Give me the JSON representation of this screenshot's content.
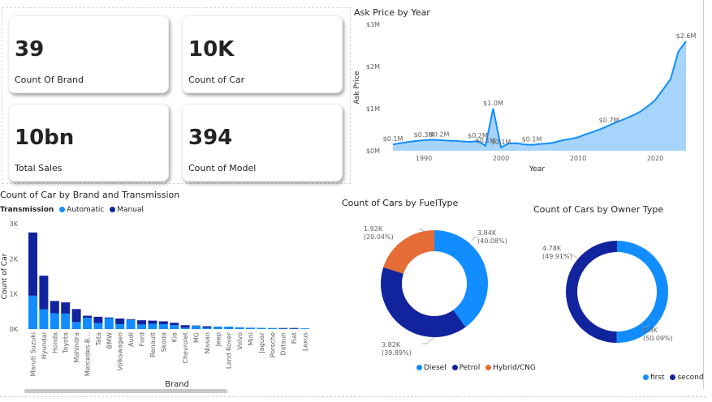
{
  "cards": [
    {
      "value": "39",
      "label": "Count Of Brand"
    },
    {
      "value": "10K",
      "label": "Count of Car"
    },
    {
      "value": "10bn",
      "label": "Total Sales"
    },
    {
      "value": "394",
      "label": "Count of Model"
    }
  ],
  "colors": {
    "automatic": "#118DFF",
    "manual": "#12239E",
    "hybrid": "#E66C37",
    "area": "#A7D4FB",
    "line": "#118DFF"
  },
  "chart_data": [
    {
      "type": "area",
      "title": "Ask Price by Year",
      "xlabel": "Year",
      "ylabel": "Ask Price",
      "x_ticks": [
        "1990",
        "2000",
        "2010",
        "2020"
      ],
      "y_ticks": [
        "$0M",
        "$1M",
        "$2M",
        "$3M"
      ],
      "ylim": [
        0,
        3000000
      ],
      "xlim": [
        1986,
        2024
      ],
      "x": [
        1986,
        1987,
        1988,
        1989,
        1990,
        1991,
        1992,
        1993,
        1994,
        1995,
        1996,
        1997,
        1998,
        1999,
        2000,
        2001,
        2002,
        2003,
        2004,
        2005,
        2006,
        2007,
        2008,
        2009,
        2010,
        2011,
        2012,
        2013,
        2014,
        2015,
        2016,
        2017,
        2018,
        2019,
        2020,
        2021,
        2022,
        2023,
        2024
      ],
      "y": [
        150000,
        180000,
        210000,
        230000,
        250000,
        260000,
        255000,
        240000,
        235000,
        220000,
        210000,
        230000,
        120000,
        1000000,
        80000,
        170000,
        180000,
        150000,
        140000,
        160000,
        170000,
        200000,
        250000,
        280000,
        320000,
        390000,
        450000,
        520000,
        600000,
        680000,
        750000,
        830000,
        920000,
        1050000,
        1200000,
        1450000,
        1700000,
        2350000,
        2600000
      ],
      "data_labels": [
        {
          "x": 1986,
          "y": 150000,
          "text": "$0.1M"
        },
        {
          "x": 1990,
          "y": 250000,
          "text": "$0.3M"
        },
        {
          "x": 1992,
          "y": 255000,
          "text": "$0.2M"
        },
        {
          "x": 1997,
          "y": 230000,
          "text": "$0.2M"
        },
        {
          "x": 1998,
          "y": 120000,
          "text": "$0.1M"
        },
        {
          "x": 1999,
          "y": 1000000,
          "text": "$1.0M"
        },
        {
          "x": 2000,
          "y": 80000,
          "text": "$0.1M"
        },
        {
          "x": 2004,
          "y": 140000,
          "text": "$0.1M"
        },
        {
          "x": 2014,
          "y": 600000,
          "text": "$0.7M"
        },
        {
          "x": 2024,
          "y": 2600000,
          "text": "$2.6M"
        }
      ],
      "grid": false
    },
    {
      "type": "bar",
      "title": "Count of Car by Brand and Transmission",
      "legend_title": "Transmission",
      "xlabel": "Brand",
      "ylabel": "Count of Car",
      "y_ticks": [
        "0K",
        "1K",
        "2K",
        "3K"
      ],
      "ylim": [
        0,
        3000
      ],
      "stacked": true,
      "categories": [
        "Maruti Suzuki",
        "Hyundai",
        "Honda",
        "Toyota",
        "Mahindra",
        "Mercedes-B...",
        "Tata",
        "BMW",
        "Volkswagen",
        "Audi",
        "Ford",
        "Renault",
        "Skoda",
        "Kia",
        "Chevrolet",
        "MG",
        "Nissan",
        "Jeep",
        "Land Rover",
        "Volvo",
        "Mini",
        "Jaguar",
        "Porsche",
        "Datsun",
        "Fiat",
        "Lexus"
      ],
      "series": [
        {
          "name": "Automatic",
          "values": [
            950,
            560,
            450,
            440,
            200,
            320,
            170,
            310,
            140,
            260,
            130,
            150,
            140,
            110,
            40,
            90,
            40,
            70,
            70,
            50,
            40,
            35,
            30,
            10,
            10,
            20
          ]
        },
        {
          "name": "Manual",
          "values": [
            1800,
            960,
            350,
            320,
            370,
            60,
            180,
            20,
            160,
            20,
            120,
            90,
            80,
            70,
            70,
            10,
            40,
            0,
            0,
            0,
            0,
            0,
            0,
            20,
            20,
            0
          ]
        }
      ]
    },
    {
      "type": "pie",
      "title": "Count of Cars by FuelType",
      "donut": true,
      "categories": [
        "Diesel",
        "Petrol",
        "Hybrid/CNG"
      ],
      "values": [
        3840,
        3820,
        1920
      ],
      "labels": [
        "3.84K (40.08%)",
        "3.82K (39.89%)",
        "1.92K (20.04%)"
      ],
      "legend": "bottom"
    },
    {
      "type": "pie",
      "title": "Count of Cars by Owner Type",
      "donut": true,
      "categories": [
        "first",
        "second"
      ],
      "values": [
        4800,
        4780
      ],
      "labels": [
        "4.8K (50.09%)",
        "4.78K (49.91%)"
      ],
      "legend": "bottom-right"
    }
  ]
}
